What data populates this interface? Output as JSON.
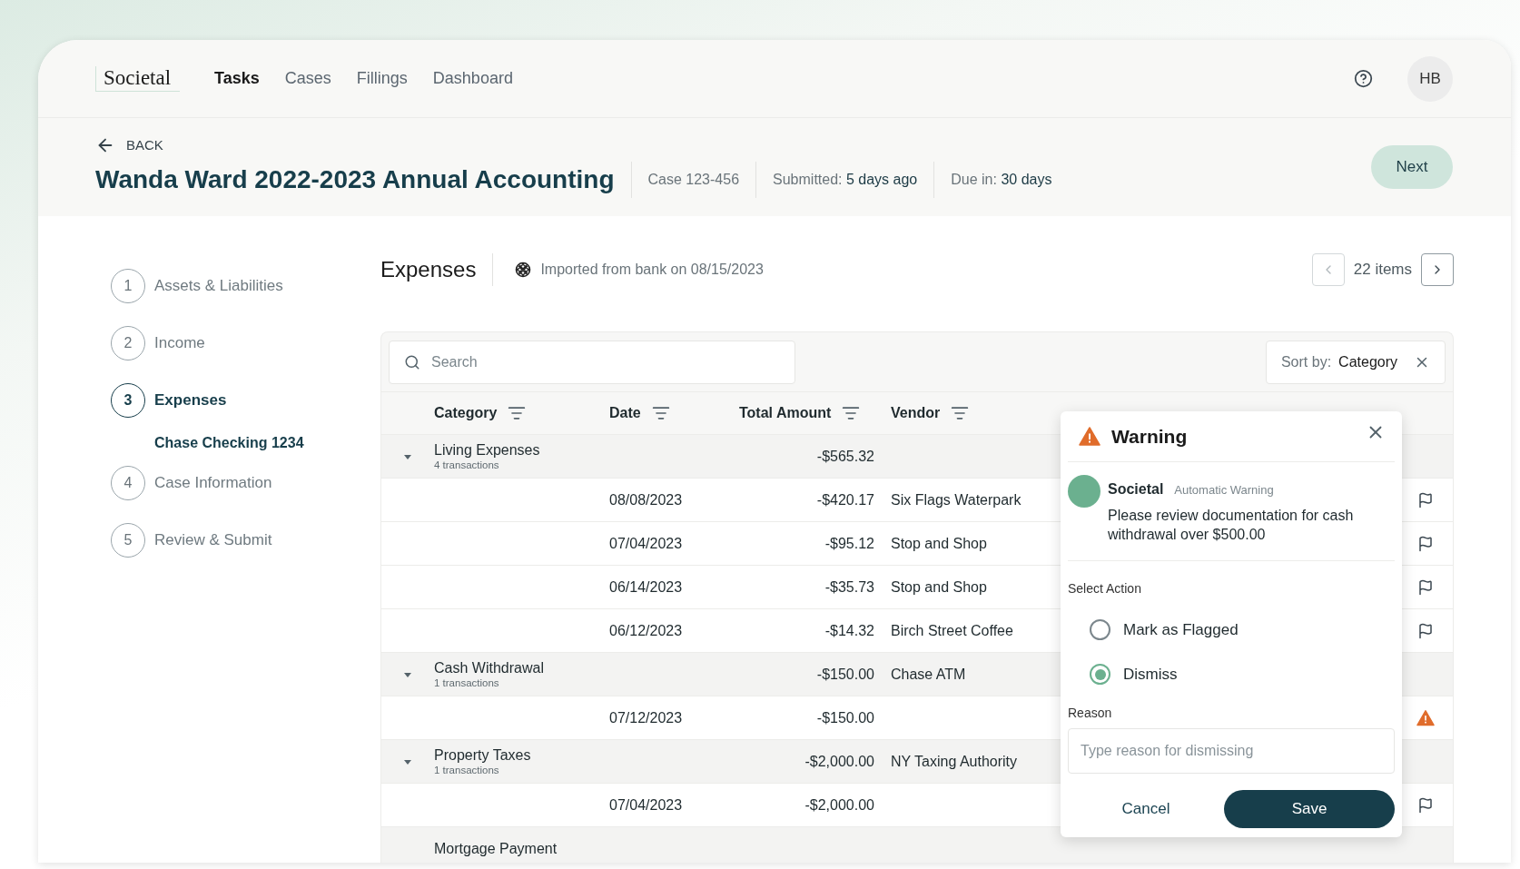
{
  "nav": {
    "logo": "Societal",
    "tabs": [
      {
        "label": "Tasks",
        "selected": true
      },
      {
        "label": "Cases",
        "selected": false
      },
      {
        "label": "Fillings",
        "selected": false
      },
      {
        "label": "Dashboard",
        "selected": false
      }
    ],
    "avatar": "HB"
  },
  "header": {
    "back": "BACK",
    "title": "Wanda Ward 2022-2023 Annual Accounting",
    "meta": [
      {
        "label": "Case 123-456"
      },
      {
        "label": "Submitted:",
        "value": "5 days ago"
      },
      {
        "label": "Due in:",
        "value": "30 days"
      }
    ],
    "next": "Next"
  },
  "steps": [
    {
      "number": "1",
      "label": "Assets & Liabilities",
      "selected": false
    },
    {
      "number": "2",
      "label": "Income",
      "selected": false
    },
    {
      "number": "3",
      "label": "Expenses",
      "selected": true,
      "children": [
        {
          "label": "Chase Checking 1234"
        }
      ]
    },
    {
      "number": "4",
      "label": "Case Information",
      "selected": false
    },
    {
      "number": "5",
      "label": "Review & Submit",
      "selected": false
    }
  ],
  "section": {
    "title": "Expenses",
    "source": "Imported from bank on 08/15/2023",
    "count": "22 items"
  },
  "table": {
    "search_placeholder": "Search",
    "sort_label": "Sort by:",
    "sort_value": "Category",
    "columns": [
      "Category",
      "Date",
      "Total Amount",
      "Vendor"
    ],
    "rows": [
      {
        "kind": "group",
        "category": "Living Expenses",
        "count": "4 transactions",
        "amount": "-$565.32",
        "expanded": true
      },
      {
        "kind": "transaction",
        "date": "08/08/2023",
        "amount": "-$420.17",
        "vendor": "Six Flags Waterpark",
        "warning": false
      },
      {
        "kind": "transaction",
        "date": "07/04/2023",
        "amount": "-$95.12",
        "vendor": "Stop and Shop",
        "warning": false
      },
      {
        "kind": "transaction",
        "date": "06/14/2023",
        "amount": "-$35.73",
        "vendor": "Stop and Shop",
        "warning": false
      },
      {
        "kind": "transaction",
        "date": "06/12/2023",
        "amount": "-$14.32",
        "vendor": "Birch Street Coffee",
        "warning": false
      },
      {
        "kind": "group",
        "category": "Cash Withdrawal",
        "count": "1 transactions",
        "amount": "-$150.00",
        "vendor": "Chase ATM",
        "expanded": true
      },
      {
        "kind": "transaction",
        "date": "07/12/2023",
        "amount": "-$150.00",
        "warning": true
      },
      {
        "kind": "group",
        "category": "Property Taxes",
        "count": "1 transactions",
        "amount": "-$2,000.00",
        "vendor": "NY Taxing Authority",
        "expanded": true
      },
      {
        "kind": "transaction",
        "date": "07/04/2023",
        "amount": "-$2,000.00",
        "warning": false
      },
      {
        "kind": "group",
        "category": "Mortgage Payment"
      }
    ]
  },
  "popover": {
    "title": "Warning",
    "author": "Societal",
    "tag": "Automatic Warning",
    "message": "Please review documentation for cash withdrawal over $500.00",
    "action_label": "Select Action",
    "options": [
      {
        "label": "Mark as Flagged",
        "selected": false
      },
      {
        "label": "Dismiss",
        "selected": true
      }
    ],
    "reason_label": "Reason",
    "reason_placeholder": "Type reason for dismissing",
    "cancel": "Cancel",
    "save": "Save"
  }
}
